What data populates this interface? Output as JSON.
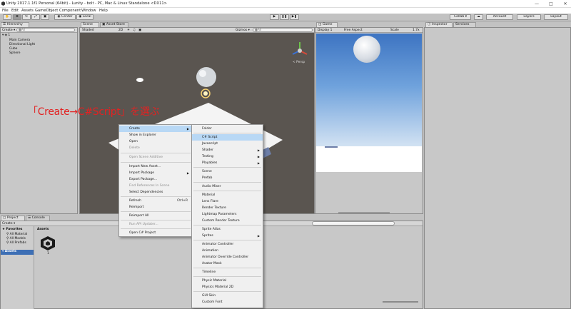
{
  "window": {
    "title": "Unity 2017.1.1f1 Personal (64bit) - Lunity - bolt - PC, Mac & Linux Standalone <DX11>",
    "controls": [
      "—",
      "□",
      "✕"
    ]
  },
  "menubar": [
    "File",
    "Edit",
    "Assets",
    "GameObject",
    "Component",
    "Window",
    "Help"
  ],
  "toolbar": {
    "center_label": "Center",
    "local_label": "Local",
    "collab_label": "Collab ▾",
    "account_label": "Account",
    "layers_label": "Layers",
    "layout_label": "Layout"
  },
  "hierarchy": {
    "tab": "Hierarchy",
    "create": "Create ▾",
    "search_placeholder": "●All",
    "scene_name": "1",
    "items": [
      "Main Camera",
      "Directional Light",
      "Cube",
      "Sphere"
    ]
  },
  "scene": {
    "tab": "Scene",
    "tab2": "Asset Store",
    "shading": "Shaded",
    "mode_2d": "2D",
    "gizmos": "Gizmos ▾",
    "search_placeholder": "●All",
    "persp": "< Persp"
  },
  "game": {
    "tab": "Game",
    "display": "Display 1",
    "aspect": "Free Aspect",
    "scale_label": "Scale",
    "scale_value": "1.7x"
  },
  "inspector": {
    "tab": "Inspector",
    "tab2": "Services"
  },
  "project": {
    "tab": "Project",
    "tab2": "Console",
    "create": "Create ▾",
    "favorites": "Favorites",
    "fav_items": [
      "All Material",
      "All Models",
      "All Prefabs"
    ],
    "assets_root": "Assets",
    "assets_header": "Assets",
    "asset_item": "1"
  },
  "annotation": "「Create→C#Script」を選ぶ",
  "context_menu": {
    "items": [
      {
        "label": "Create",
        "arrow": true,
        "hl": true
      },
      {
        "label": "Show in Explorer"
      },
      {
        "label": "Open"
      },
      {
        "label": "Delete",
        "dis": true
      },
      {
        "label": "Open Scene Additive",
        "dis": true
      },
      {
        "label": "Import New Asset..."
      },
      {
        "label": "Import Package",
        "arrow": true
      },
      {
        "label": "Export Package..."
      },
      {
        "label": "Find References In Scene",
        "dis": true
      },
      {
        "label": "Select Dependencies"
      },
      {
        "label": "Refresh",
        "shortcut": "Ctrl+R"
      },
      {
        "label": "Reimport"
      },
      {
        "label": "Reimport All"
      },
      {
        "label": "Run API Updater...",
        "dis": true
      },
      {
        "label": "Open C# Project"
      }
    ]
  },
  "create_menu": {
    "items": [
      {
        "label": "Folder"
      },
      {
        "label": "C# Script",
        "hl": true
      },
      {
        "label": "Javascript"
      },
      {
        "label": "Shader",
        "arrow": true
      },
      {
        "label": "Testing",
        "arrow": true
      },
      {
        "label": "Playables",
        "arrow": true
      },
      {
        "label": "Scene"
      },
      {
        "label": "Prefab"
      },
      {
        "label": "Audio Mixer"
      },
      {
        "label": "Material"
      },
      {
        "label": "Lens Flare"
      },
      {
        "label": "Render Texture"
      },
      {
        "label": "Lightmap Parameters"
      },
      {
        "label": "Custom Render Texture"
      },
      {
        "label": "Sprite Atlas"
      },
      {
        "label": "Sprites",
        "arrow": true
      },
      {
        "label": "Animator Controller"
      },
      {
        "label": "Animation"
      },
      {
        "label": "Animator Override Controller"
      },
      {
        "label": "Avatar Mask"
      },
      {
        "label": "Timeline"
      },
      {
        "label": "Physic Material"
      },
      {
        "label": "Physics Material 2D"
      },
      {
        "label": "GUI Skin"
      },
      {
        "label": "Custom Font"
      }
    ]
  },
  "colors": {
    "annotation": "#e22222",
    "highlight": "#b8d8f5",
    "scene_bg": "#5a5550",
    "sky_top": "#3d74c2"
  }
}
